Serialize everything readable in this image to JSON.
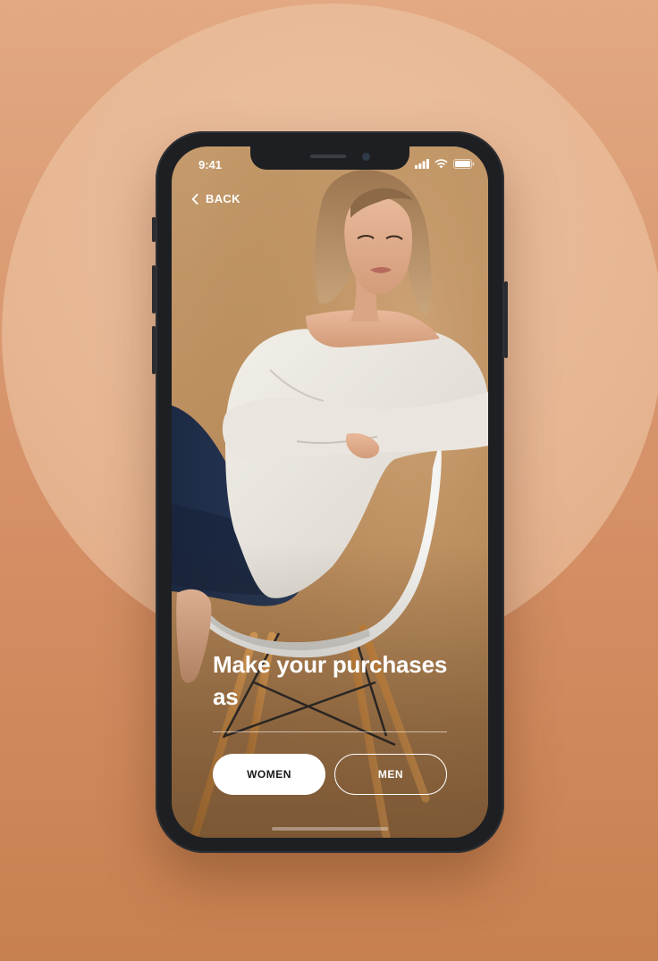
{
  "status_bar": {
    "time": "9:41"
  },
  "nav": {
    "back_label": "BACK"
  },
  "hero": {
    "headline": "Make your purchases as"
  },
  "options": {
    "women_label": "WOMEN",
    "men_label": "MEN",
    "selected": "WOMEN"
  },
  "icons": {
    "back": "chevron-left-icon",
    "signal": "signal-icon",
    "wifi": "wifi-icon",
    "battery": "battery-icon"
  },
  "colors": {
    "background": "#d8966c",
    "halo": "#ecc1a1",
    "phone_frame": "#1d1f22",
    "button_fill": "#ffffff",
    "button_text": "#1a1a1a"
  }
}
